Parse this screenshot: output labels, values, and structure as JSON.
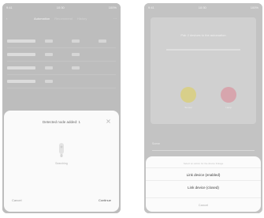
{
  "left_screen": {
    "status": {
      "time": "9:41",
      "carrier": "10:30",
      "battery": "100%"
    },
    "nav": {
      "back_label": "‹",
      "tabs": [
        "Automation",
        "Recommend",
        "History"
      ],
      "more_label": "···"
    },
    "table": {
      "rows": [
        {
          "cols": 3
        },
        {
          "cols": 2
        },
        {
          "cols": 2
        },
        {
          "cols": 1
        }
      ]
    },
    "dialog": {
      "title": "Detected node added: 1",
      "status": "Searching",
      "cancel_label": "Cancel",
      "confirm_label": "Continue"
    }
  },
  "right_screen": {
    "status": {
      "time": "9:41",
      "carrier": "10:30",
      "battery": "100%"
    },
    "card": {
      "heading": "Pair 2 devices to the automation",
      "device_a": "Sensor",
      "device_b": "Lamp"
    },
    "footer_label": "Scene",
    "action_sheet": {
      "hint": "Select an action for the device linkage",
      "option_1": "Link device (enabled)",
      "option_2": "Link device (closed)",
      "cancel_label": "Cancel"
    }
  },
  "colors": {
    "overlay": "#b8b8b8",
    "sheet_bg": "#fafafa",
    "device_a": "#d8cf8a",
    "device_b": "#d7a5ad"
  }
}
